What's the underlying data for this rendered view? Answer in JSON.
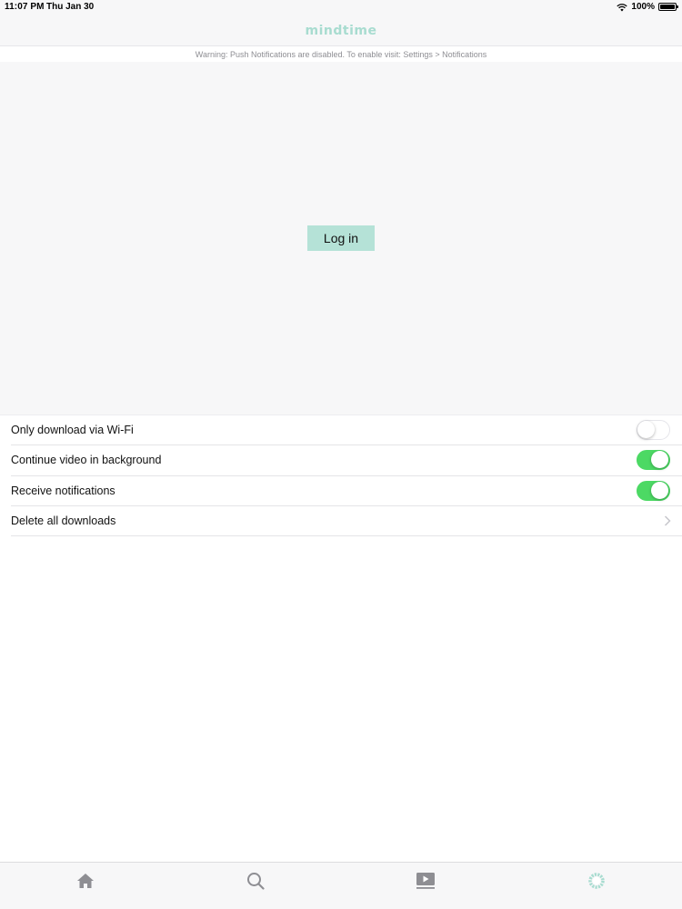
{
  "status_bar": {
    "time": "11:07 PM",
    "date": "Thu Jan 30",
    "battery": "100%"
  },
  "header": {
    "logo": "mindtime",
    "warning": "Warning: Push Notifications are disabled. To enable visit: Settings > Notifications"
  },
  "login": {
    "button_label": "Log in"
  },
  "settings": {
    "rows": [
      {
        "label": "Only download via Wi-Fi",
        "type": "toggle",
        "on": false
      },
      {
        "label": "Continue video in background",
        "type": "toggle",
        "on": true
      },
      {
        "label": "Receive notifications",
        "type": "toggle",
        "on": true
      },
      {
        "label": "Delete all downloads",
        "type": "disclosure"
      }
    ]
  },
  "tab_bar": {
    "tabs": [
      {
        "icon": "home-icon",
        "active": false
      },
      {
        "icon": "search-icon",
        "active": false
      },
      {
        "icon": "video-icon",
        "active": false
      },
      {
        "icon": "settings-icon",
        "active": true
      }
    ]
  },
  "colors": {
    "accent": "#a8dcd0",
    "login_button": "#b5e2d7",
    "toggle_on": "#4cd964",
    "tab_inactive": "#8e8e93"
  }
}
